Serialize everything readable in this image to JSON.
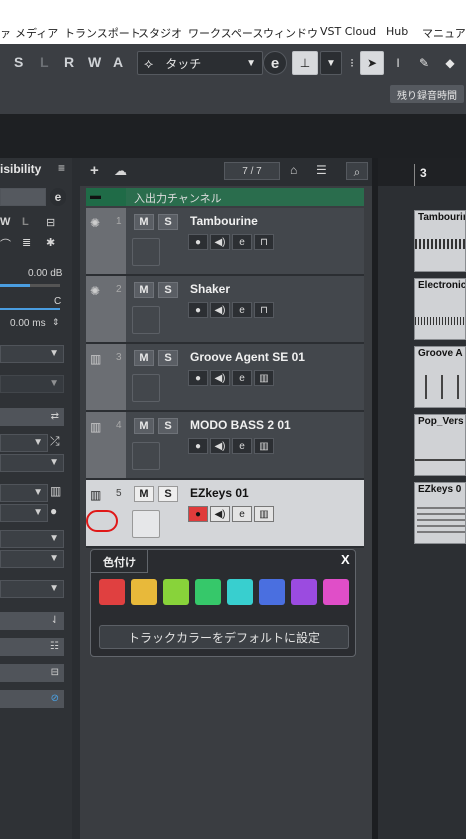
{
  "menu": [
    "ァ",
    "メディア",
    "トランスポート",
    "スタジオ",
    "ワークスペース",
    "ウィンドウ",
    "VST Cloud",
    "Hub",
    "マニュアル"
  ],
  "toolbar": {
    "letters": [
      "S",
      "L",
      "R",
      "W",
      "A"
    ],
    "automation_mode": "タッチ",
    "record_time_label": "残り録音時間"
  },
  "inspector": {
    "title_fragment": "isibility",
    "level": "0.00 dB",
    "pan": "C",
    "delay": "0.00 ms"
  },
  "tracklist": {
    "count": "7 / 7",
    "folder_name": "入出力チャンネル",
    "tracks": [
      {
        "num": "1",
        "name": "Tambourine",
        "type": "audio"
      },
      {
        "num": "2",
        "name": "Shaker",
        "type": "audio"
      },
      {
        "num": "3",
        "name": "Groove Agent SE 01",
        "type": "instrument"
      },
      {
        "num": "4",
        "name": "MODO BASS 2 01",
        "type": "instrument"
      },
      {
        "num": "5",
        "name": "EZkeys 01",
        "type": "instrument"
      }
    ],
    "mute_label": "M",
    "solo_label": "S"
  },
  "color_popup": {
    "title": "色付け",
    "close_label": "X",
    "reset_label": "トラックカラーをデフォルトに設定",
    "swatches": [
      "#e04040",
      "#e8b93a",
      "#88d33a",
      "#36c86a",
      "#38cfcf",
      "#4a6fe0",
      "#9b4be0",
      "#e04ec8"
    ]
  },
  "arrange": {
    "bar_number": "3",
    "parts": [
      "Tambourine",
      "Electronic",
      "Groove A",
      "Pop_Vers",
      "EZkeys 0"
    ]
  },
  "colors": {
    "accent_green": "#1f6b47",
    "record_red": "#e03b3b",
    "annotation_red": "#e01818"
  }
}
